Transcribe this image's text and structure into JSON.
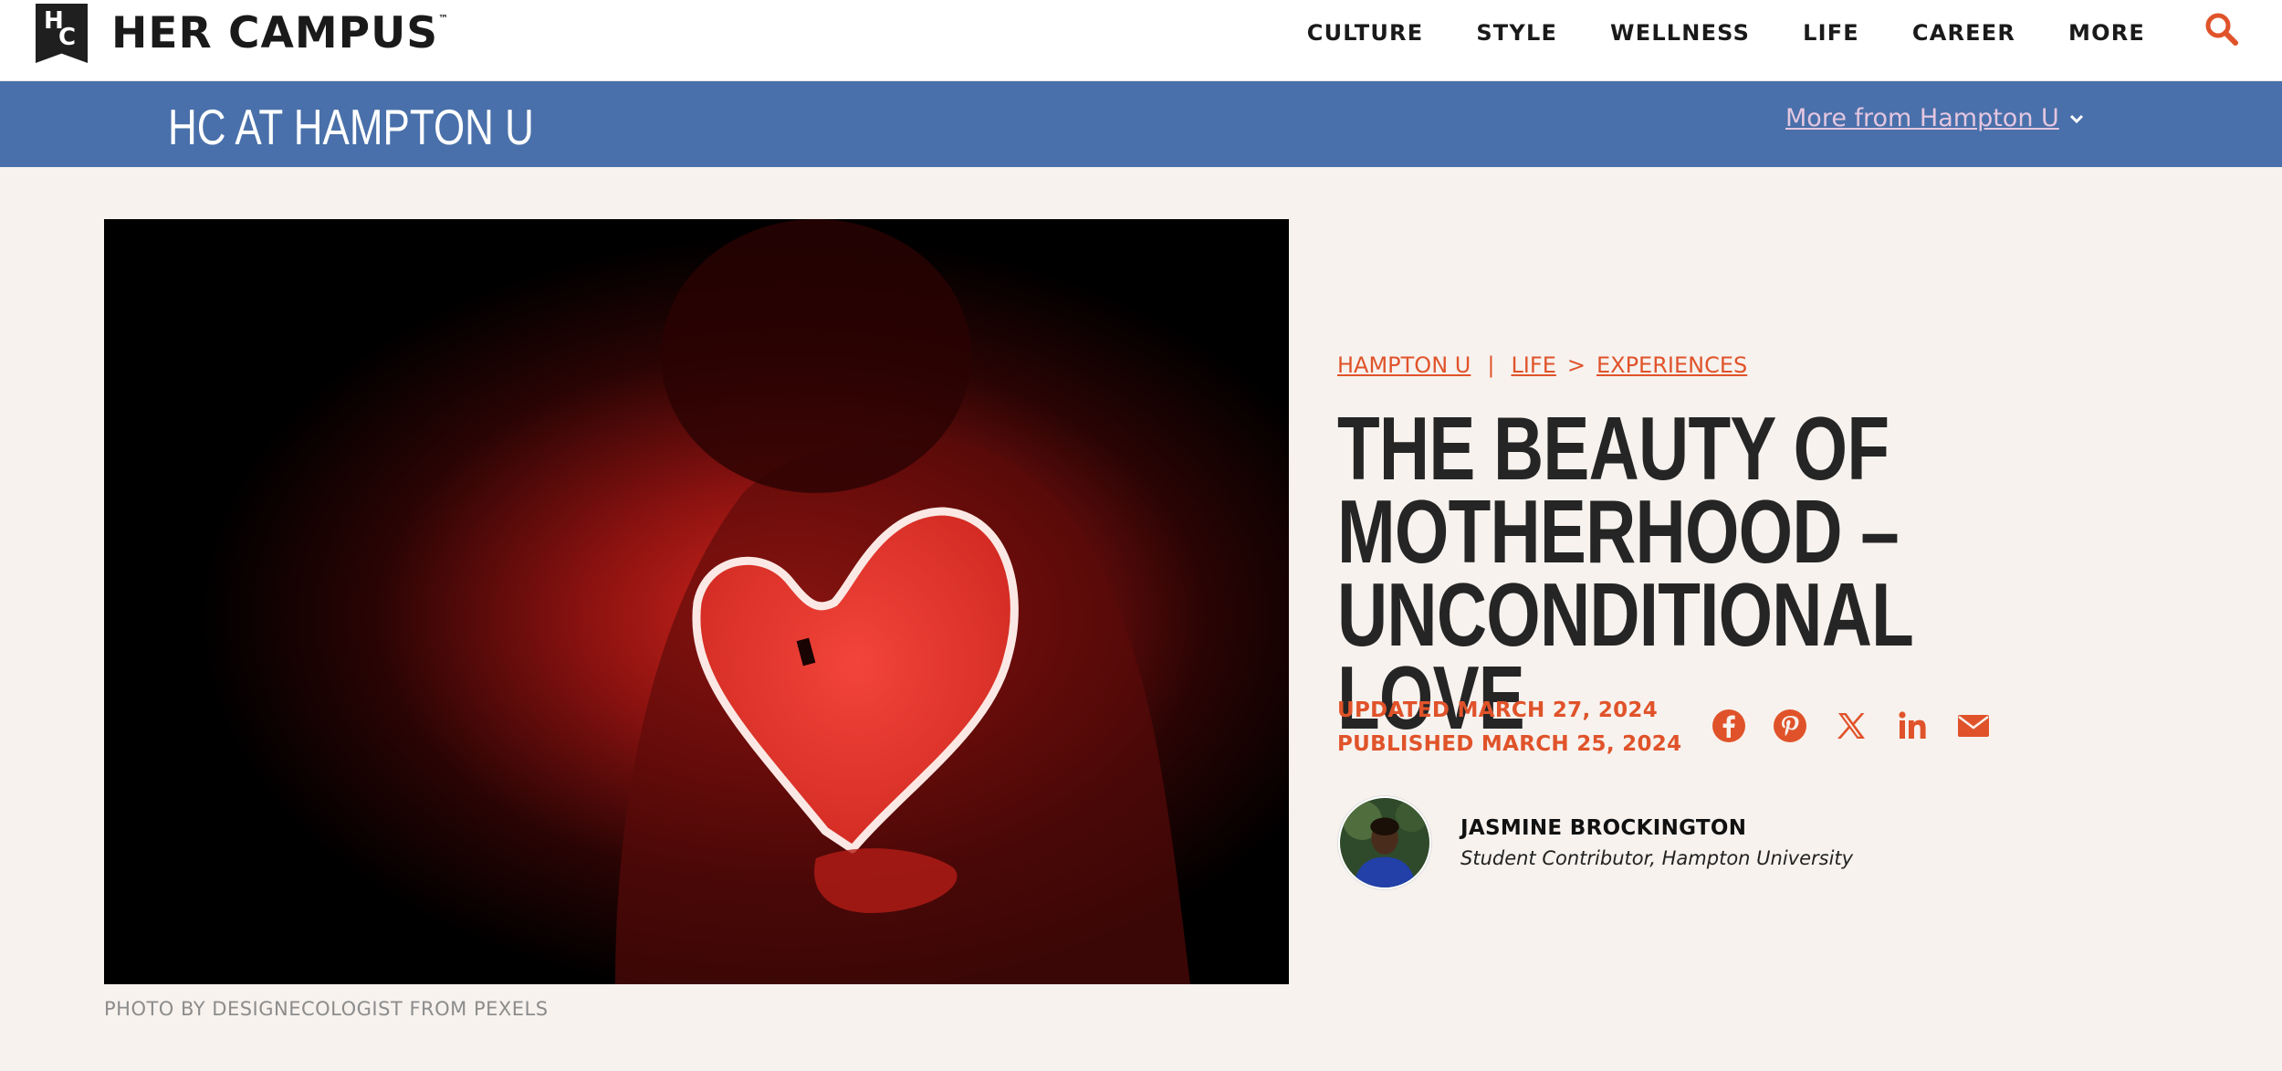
{
  "site": {
    "logo_text": "HER CAMPUS",
    "logo_trademark": "™",
    "logo_mark_letters": [
      "H",
      "C"
    ]
  },
  "nav": {
    "items": [
      "CULTURE",
      "STYLE",
      "WELLNESS",
      "LIFE",
      "CAREER",
      "MORE"
    ],
    "search_icon": "search-icon"
  },
  "chapter": {
    "title": "HC AT HAMPTON U",
    "more_link": "More from Hampton U"
  },
  "hero": {
    "caption": "PHOTO BY DESIGNECOLOGIST FROM PEXELS"
  },
  "article": {
    "breadcrumb": {
      "chapter": "HAMPTON U",
      "separator": "|",
      "section": "LIFE",
      "arrow": ">",
      "subsection": "EXPERIENCES"
    },
    "title": "THE BEAUTY OF MOTHERHOOD – UNCONDITIONAL LOVE",
    "updated": "UPDATED MARCH 27, 2024",
    "published": "PUBLISHED MARCH 25, 2024",
    "share_icons": [
      "facebook-icon",
      "pinterest-icon",
      "x-icon",
      "linkedin-icon",
      "email-icon"
    ],
    "author": {
      "name": "JASMINE BROCKINGTON",
      "role": "Student Contributor, Hampton University"
    }
  },
  "colors": {
    "accent": "#e0532a",
    "chapter_bar": "#4970aa",
    "page_bg": "#f7f2ee",
    "more_link": "#e4c6e0"
  }
}
